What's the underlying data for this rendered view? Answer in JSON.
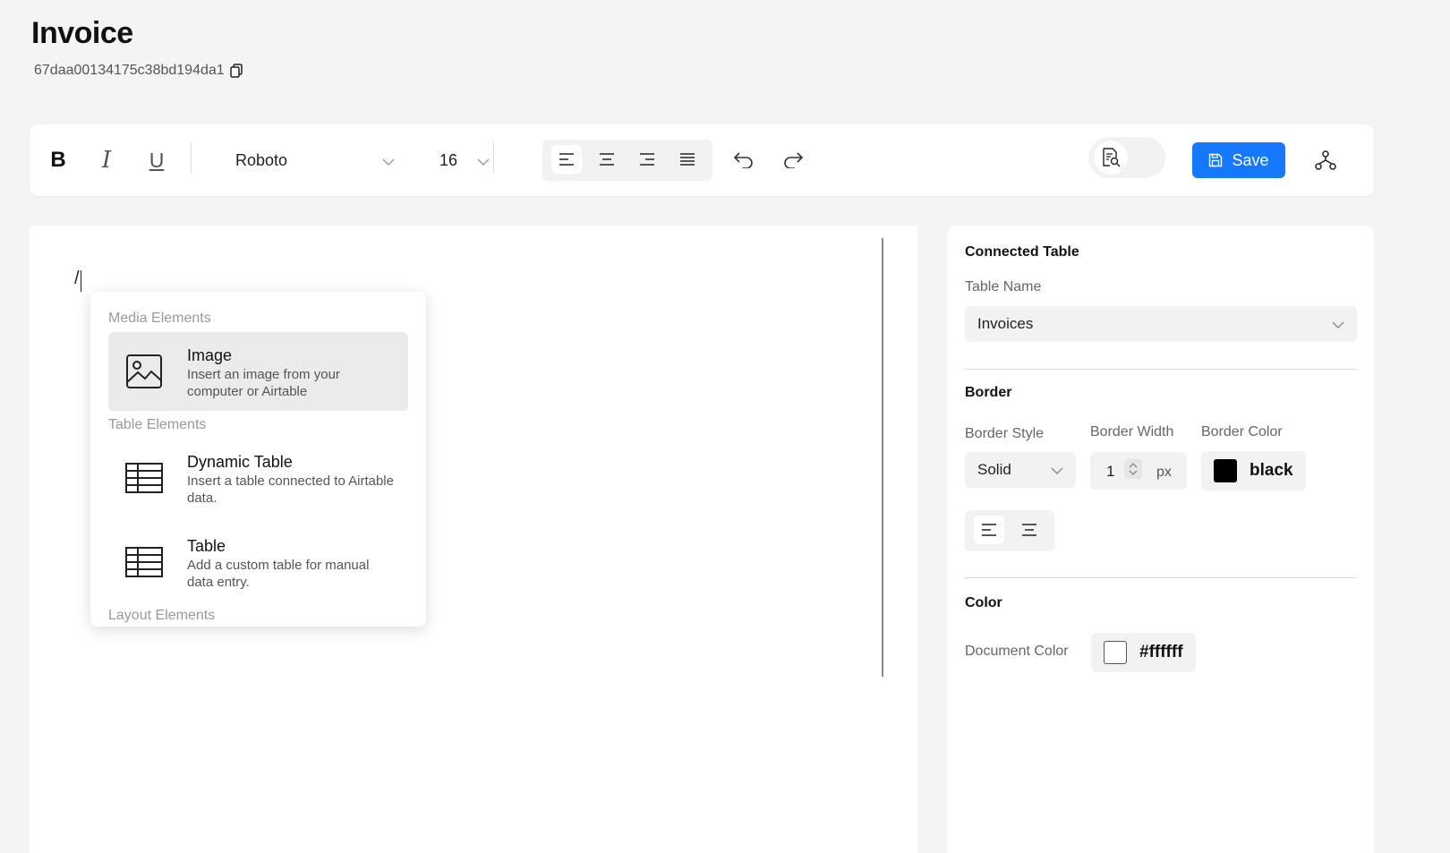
{
  "page": {
    "title": "Invoice",
    "doc_id": "67daa00134175c38bd194da1"
  },
  "toolbar": {
    "bold_label": "B",
    "italic_label": "I",
    "underline_label": "U",
    "font_family": "Roboto",
    "font_size": "16",
    "save_label": "Save"
  },
  "editor": {
    "text": "/"
  },
  "slash_menu": {
    "sections": [
      "Media Elements",
      "Table Elements",
      "Layout Elements"
    ],
    "items": [
      {
        "title": "Image",
        "description": "Insert an image from your computer or Airtable",
        "icon": "image-icon"
      },
      {
        "title": "Dynamic Table",
        "description": "Insert a table connected to Airtable data.",
        "icon": "table-icon"
      },
      {
        "title": "Table",
        "description": "Add a custom table for manual data entry.",
        "icon": "table-icon"
      }
    ]
  },
  "panel": {
    "connected_table": {
      "heading": "Connected Table",
      "label": "Table Name",
      "value": "Invoices"
    },
    "border": {
      "heading": "Border",
      "style_label": "Border Style",
      "style_value": "Solid",
      "width_label": "Border Width",
      "width_value": "1",
      "width_unit": "px",
      "color_label": "Border Color",
      "color_value": "black",
      "color_hex": "#000000"
    },
    "color": {
      "heading": "Color",
      "doc_color_label": "Document Color",
      "doc_color_value": "#ffffff"
    }
  },
  "colors": {
    "accent": "#1677ff",
    "background": "#f4f4f4"
  }
}
